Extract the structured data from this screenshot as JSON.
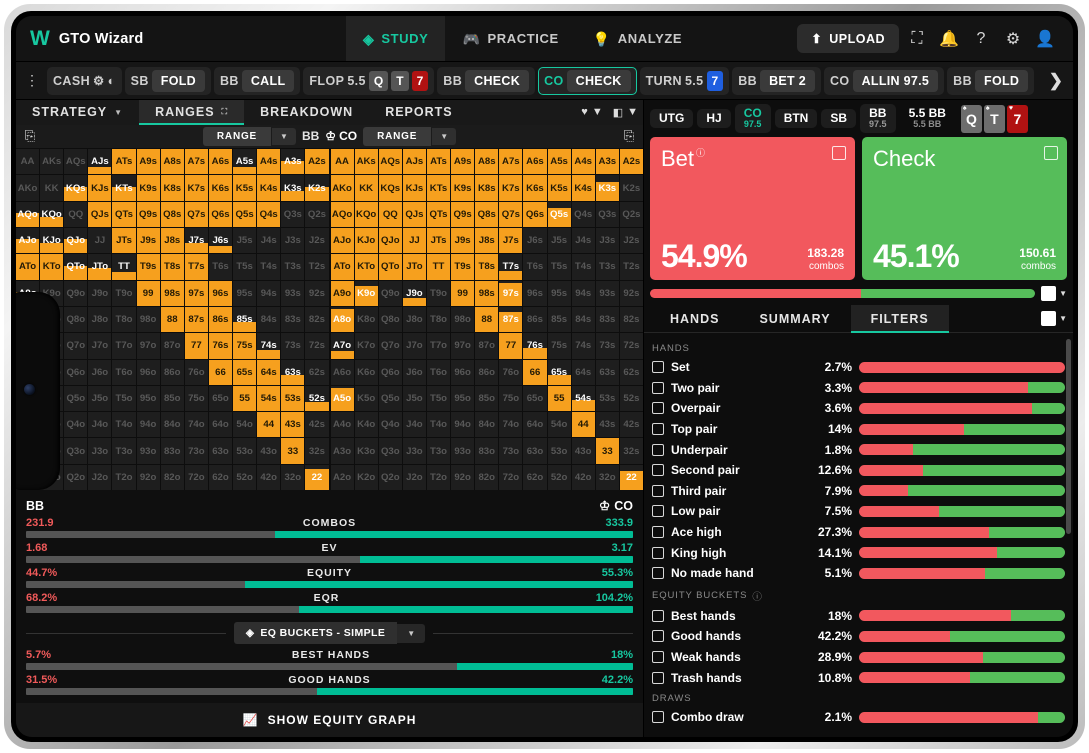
{
  "app": {
    "brand": "GTO Wizard",
    "logo_icon": "w-logo-icon"
  },
  "topnav": {
    "items": [
      {
        "label": "STUDY",
        "icon": "study-icon",
        "active": true
      },
      {
        "label": "PRACTICE",
        "icon": "gamepad-icon",
        "active": false
      },
      {
        "label": "ANALYZE",
        "icon": "lightbulb-icon",
        "active": false
      }
    ],
    "upload_label": "UPLOAD",
    "upload_icon": "upload-icon",
    "icons": [
      "scan-icon",
      "bell-icon",
      "help-icon",
      "gear-icon",
      "account-icon"
    ]
  },
  "actionbar": {
    "kebab_icon": "kebab-menu-icon",
    "game_type": "CASH",
    "gear_icon": "gear-icon",
    "contrast_icon": "contrast-icon",
    "nodes": [
      {
        "pos": "SB",
        "action": "FOLD"
      },
      {
        "pos": "BB",
        "action": "CALL"
      }
    ],
    "flop": {
      "label": "FLOP",
      "pot": "5.5",
      "cards": [
        {
          "rank": "Q",
          "suit": "♠",
          "color": "black"
        },
        {
          "rank": "T",
          "suit": "♠",
          "color": "black"
        },
        {
          "rank": "7",
          "suit": "♥",
          "color": "red"
        }
      ]
    },
    "flop_nodes": [
      {
        "pos": "BB",
        "action": "CHECK",
        "selected": false
      },
      {
        "pos": "CO",
        "action": "CHECK",
        "selected": true
      }
    ],
    "turn": {
      "label": "TURN",
      "pot": "5.5",
      "card": {
        "rank": "7",
        "suit": "♦",
        "color": "blue"
      }
    },
    "turn_nodes": [
      {
        "pos": "BB",
        "action": "BET 2"
      },
      {
        "pos": "CO",
        "action": "ALLIN 97.5"
      },
      {
        "pos": "BB",
        "action": "FOLD"
      }
    ],
    "next_icon": "chevron-right-icon"
  },
  "lefttabs": {
    "items": [
      {
        "label": "STRATEGY",
        "icon": "caret-down-icon",
        "active": false
      },
      {
        "label": "RANGES",
        "icon": "expand-icon",
        "active": true
      },
      {
        "label": "BREAKDOWN",
        "icon": "",
        "active": false
      },
      {
        "label": "REPORTS",
        "icon": "",
        "active": false
      }
    ],
    "suit_icon": "heart-icon",
    "board_icon": "board-icon"
  },
  "rangerow": {
    "copy_icon": "copy-icon",
    "left_select": {
      "label": "RANGE",
      "caret": "caret-down-icon"
    },
    "left_pos": "BB",
    "right_pos": "CO",
    "crown_icon": "crown-icon",
    "right_select": {
      "label": "RANGE",
      "caret": "caret-down-icon"
    }
  },
  "grid": {
    "ranks": [
      "A",
      "K",
      "Q",
      "J",
      "T",
      "9",
      "8",
      "7",
      "6",
      "5",
      "4",
      "3",
      "2"
    ],
    "left": {
      "AA": 0,
      "AKs": 0,
      "AQs": 0,
      "AJs": 0.3,
      "ATs": 1,
      "A9s": 1,
      "A8s": 1,
      "A7s": 1,
      "A6s": 1,
      "A5s": 0.3,
      "A4s": 1,
      "A3s": 0.55,
      "A2s": 1,
      "AKo": 0,
      "KK": 0,
      "KQs": 0.55,
      "KJs": 1,
      "KTs": 0.55,
      "K9s": 1,
      "K8s": 1,
      "K7s": 1,
      "K6s": 1,
      "K5s": 1,
      "K4s": 1,
      "K3s": 0.4,
      "K2s": 0.55,
      "AQo": 0.55,
      "KQo": 0.4,
      "QQ": 0,
      "QJs": 1,
      "QTs": 1,
      "Q9s": 1,
      "Q8s": 1,
      "Q7s": 1,
      "Q6s": 1,
      "Q5s": 1,
      "Q4s": 1,
      "Q3s": 0,
      "Q2s": 0,
      "AJo": 0.55,
      "KJo": 0.4,
      "QJo": 0.55,
      "JJ": 0,
      "JTs": 1,
      "J9s": 1,
      "J8s": 1,
      "J7s": 0.4,
      "J6s": 0.3,
      "J5s": 0,
      "J4s": 0,
      "J3s": 0,
      "J2s": 0,
      "ATo": 1,
      "KTo": 1,
      "QTo": 0.55,
      "JTo": 0.45,
      "TT": 0.3,
      "T9s": 1,
      "T8s": 1,
      "T7s": 1,
      "T6s": 0,
      "T5s": 0,
      "T4s": 0,
      "T3s": 0,
      "T2s": 0,
      "A9o": 0.55,
      "K9o": 0,
      "Q9o": 0,
      "J9o": 0,
      "T9o": 0,
      "99": 1,
      "98s": 1,
      "97s": 1,
      "96s": 1,
      "95s": 0,
      "94s": 0,
      "93s": 0,
      "92s": 0,
      "A8o": 0,
      "K8o": 0,
      "Q8o": 0,
      "J8o": 0,
      "T8o": 0,
      "98o": 0,
      "88": 1,
      "87s": 1,
      "86s": 1,
      "85s": 0.4,
      "84s": 0,
      "83s": 0,
      "82s": 0,
      "A7o": 0,
      "K7o": 0,
      "Q7o": 0,
      "J7o": 0,
      "T7o": 0,
      "97o": 0,
      "87o": 0,
      "77": 1,
      "76s": 1,
      "75s": 1,
      "74s": 0.35,
      "73s": 0,
      "72s": 0,
      "A6o": 0,
      "K6o": 0,
      "Q6o": 0,
      "J6o": 0,
      "T6o": 0,
      "96o": 0,
      "86o": 0,
      "76o": 0,
      "66": 1,
      "65s": 1,
      "64s": 1,
      "63s": 0.4,
      "62s": 0,
      "A5o": 0,
      "K5o": 0,
      "Q5o": 0,
      "J5o": 0,
      "T5o": 0,
      "95o": 0,
      "85o": 0,
      "75o": 0,
      "65o": 0,
      "55": 1,
      "54s": 1,
      "53s": 1,
      "52s": 0.35,
      "A4o": 0,
      "K4o": 0,
      "Q4o": 0,
      "J4o": 0,
      "T4o": 0,
      "94o": 0,
      "84o": 0,
      "74o": 0,
      "64o": 0,
      "54o": 0,
      "44": 1,
      "43s": 1,
      "42s": 0,
      "A3o": 0,
      "K3o": 0,
      "Q3o": 0,
      "J3o": 0,
      "T3o": 0,
      "93o": 0,
      "83o": 0,
      "73o": 0,
      "63o": 0,
      "53o": 0,
      "43o": 0,
      "33": 1,
      "32s": 0,
      "A2o": 0,
      "K2o": 0,
      "Q2o": 0,
      "J2o": 0,
      "T2o": 0,
      "92o": 0,
      "82o": 0,
      "72o": 0,
      "62o": 0,
      "52o": 0,
      "42o": 0,
      "32o": 0,
      "22": 0.85
    },
    "right": {
      "AA": 1,
      "AKs": 1,
      "AQs": 1,
      "AJs": 1,
      "ATs": 1,
      "A9s": 1,
      "A8s": 1,
      "A7s": 1,
      "A6s": 1,
      "A5s": 1,
      "A4s": 1,
      "A3s": 1,
      "A2s": 1,
      "AKo": 1,
      "KK": 1,
      "KQs": 1,
      "KJs": 1,
      "KTs": 1,
      "K9s": 1,
      "K8s": 1,
      "K7s": 1,
      "K6s": 1,
      "K5s": 1,
      "K4s": 1,
      "K3s": 0.75,
      "K2s": 0,
      "AQo": 1,
      "KQo": 1,
      "QQ": 1,
      "QJs": 1,
      "QTs": 1,
      "Q9s": 1,
      "Q8s": 1,
      "Q7s": 1,
      "Q6s": 1,
      "Q5s": 0.75,
      "Q4s": 0,
      "Q3s": 0,
      "Q2s": 0,
      "AJo": 1,
      "KJo": 1,
      "QJo": 1,
      "JJ": 1,
      "JTs": 1,
      "J9s": 1,
      "J8s": 1,
      "J7s": 1,
      "J6s": 0,
      "J5s": 0,
      "J4s": 0,
      "J3s": 0,
      "J2s": 0,
      "ATo": 1,
      "KTo": 1,
      "QTo": 1,
      "JTo": 1,
      "TT": 1,
      "T9s": 1,
      "T8s": 1,
      "T7s": 0.35,
      "T6s": 0,
      "T5s": 0,
      "T4s": 0,
      "T3s": 0,
      "T2s": 0,
      "A9o": 1,
      "K9o": 0.8,
      "Q9o": 0,
      "J9o": 0.3,
      "T9o": 0,
      "99": 1,
      "98s": 1,
      "97s": 0.9,
      "96s": 0,
      "95s": 0,
      "94s": 0,
      "93s": 0,
      "92s": 0,
      "A8o": 0.9,
      "K8o": 0,
      "Q8o": 0,
      "J8o": 0,
      "T8o": 0,
      "98o": 0,
      "88": 1,
      "87s": 0.8,
      "86s": 0,
      "85s": 0,
      "84s": 0,
      "83s": 0,
      "82s": 0,
      "A7o": 0.3,
      "K7o": 0,
      "Q7o": 0,
      "J7o": 0,
      "T7o": 0,
      "97o": 0,
      "87o": 0,
      "77": 1,
      "76s": 0.4,
      "75s": 0,
      "74s": 0,
      "73s": 0,
      "72s": 0,
      "A6o": 0,
      "K6o": 0,
      "Q6o": 0,
      "J6o": 0,
      "T6o": 0,
      "96o": 0,
      "86o": 0,
      "76o": 0,
      "66": 1,
      "65s": 0.4,
      "64s": 0,
      "63s": 0,
      "62s": 0,
      "A5o": 0.9,
      "K5o": 0,
      "Q5o": 0,
      "J5o": 0,
      "T5o": 0,
      "95o": 0,
      "85o": 0,
      "75o": 0,
      "65o": 0,
      "55": 1,
      "54s": 0.45,
      "53s": 0,
      "52s": 0,
      "A4o": 0,
      "K4o": 0,
      "Q4o": 0,
      "J4o": 0,
      "T4o": 0,
      "94o": 0,
      "84o": 0,
      "74o": 0,
      "64o": 0,
      "54o": 0,
      "44": 1,
      "43s": 0,
      "42s": 0,
      "A3o": 0,
      "K3o": 0,
      "Q3o": 0,
      "J3o": 0,
      "T3o": 0,
      "93o": 0,
      "83o": 0,
      "73o": 0,
      "63o": 0,
      "53o": 0,
      "43o": 0,
      "33": 1,
      "32s": 0,
      "A2o": 0,
      "K2o": 0,
      "Q2o": 0,
      "J2o": 0,
      "T2o": 0,
      "92o": 0,
      "82o": 0,
      "72o": 0,
      "62o": 0,
      "52o": 0,
      "42o": 0,
      "32o": 0,
      "22": 0.75
    }
  },
  "stats": {
    "left_player": "BB",
    "right_player": "CO",
    "crown_icon": "crown-icon",
    "rows": [
      {
        "name": "COMBOS",
        "left": "231.9",
        "right": "333.9",
        "split": 59
      },
      {
        "name": "EV",
        "left": "1.68",
        "right": "3.17",
        "split": 45
      },
      {
        "name": "EQUITY",
        "left": "44.7%",
        "right": "55.3%",
        "split": 64
      },
      {
        "name": "EQR",
        "left": "68.2%",
        "right": "104.2%",
        "split": 55
      }
    ],
    "selector": {
      "label": "EQ BUCKETS - SIMPLE",
      "icon": "layers-icon",
      "caret": "caret-down-icon"
    },
    "bucket_rows": [
      {
        "name": "BEST HANDS",
        "left": "5.7%",
        "right": "18%",
        "split": 29
      },
      {
        "name": "GOOD HANDS",
        "left": "31.5%",
        "right": "42.2%",
        "split": 52
      }
    ],
    "show_graph_label": "SHOW EQUITY GRAPH",
    "show_graph_icon": "line-chart-icon"
  },
  "positions": [
    {
      "label": "UTG",
      "stack": "",
      "hero": false
    },
    {
      "label": "HJ",
      "stack": "",
      "hero": false
    },
    {
      "label": "CO",
      "stack": "97.5",
      "hero": true
    },
    {
      "label": "BTN",
      "stack": "",
      "hero": false
    },
    {
      "label": "SB",
      "stack": "",
      "hero": false
    },
    {
      "label": "BB",
      "stack": "97.5",
      "hero": false
    },
    {
      "label": "5.5 BB",
      "stack": "5.5 BB",
      "hero": false,
      "pot": true
    }
  ],
  "board_cards": [
    {
      "rank": "Q",
      "suit": "♠",
      "color": "black"
    },
    {
      "rank": "T",
      "suit": "♠",
      "color": "black"
    },
    {
      "rank": "7",
      "suit": "♥",
      "color": "red"
    }
  ],
  "actions": [
    {
      "name": "Bet",
      "pct": "54.9%",
      "combos": "183.28",
      "unit": "combos",
      "color": "#f2585e",
      "has_info": true
    },
    {
      "name": "Check",
      "pct": "45.1%",
      "combos": "150.61",
      "unit": "combos",
      "color": "#56bd5a",
      "has_info": false
    }
  ],
  "stack_split": 54.9,
  "righttabs": [
    {
      "label": "HANDS",
      "active": false
    },
    {
      "label": "SUMMARY",
      "active": false
    },
    {
      "label": "FILTERS",
      "active": true
    }
  ],
  "filters": {
    "groups": [
      {
        "title": "HANDS",
        "info": false,
        "rows": [
          {
            "name": "Set",
            "pct": "2.7%",
            "red": 100
          },
          {
            "name": "Two pair",
            "pct": "3.3%",
            "red": 82
          },
          {
            "name": "Overpair",
            "pct": "3.6%",
            "red": 84
          },
          {
            "name": "Top pair",
            "pct": "14%",
            "red": 51
          },
          {
            "name": "Underpair",
            "pct": "1.8%",
            "red": 26
          },
          {
            "name": "Second pair",
            "pct": "12.6%",
            "red": 31
          },
          {
            "name": "Third pair",
            "pct": "7.9%",
            "red": 24
          },
          {
            "name": "Low pair",
            "pct": "7.5%",
            "red": 39
          },
          {
            "name": "Ace high",
            "pct": "27.3%",
            "red": 63
          },
          {
            "name": "King high",
            "pct": "14.1%",
            "red": 67
          },
          {
            "name": "No made hand",
            "pct": "5.1%",
            "red": 61
          }
        ]
      },
      {
        "title": "EQUITY BUCKETS",
        "info": true,
        "rows": [
          {
            "name": "Best hands",
            "pct": "18%",
            "red": 74
          },
          {
            "name": "Good hands",
            "pct": "42.2%",
            "red": 44
          },
          {
            "name": "Weak hands",
            "pct": "28.9%",
            "red": 60
          },
          {
            "name": "Trash hands",
            "pct": "10.8%",
            "red": 54
          }
        ]
      },
      {
        "title": "DRAWS",
        "info": false,
        "rows": [
          {
            "name": "Combo draw",
            "pct": "2.1%",
            "red": 87
          }
        ]
      }
    ]
  },
  "colors": {
    "accent": "#17c8a0",
    "range_orange": "#f6a01e",
    "bet_red": "#f2585e",
    "check_green": "#56bd5a",
    "bg": "#0d0d0d"
  }
}
